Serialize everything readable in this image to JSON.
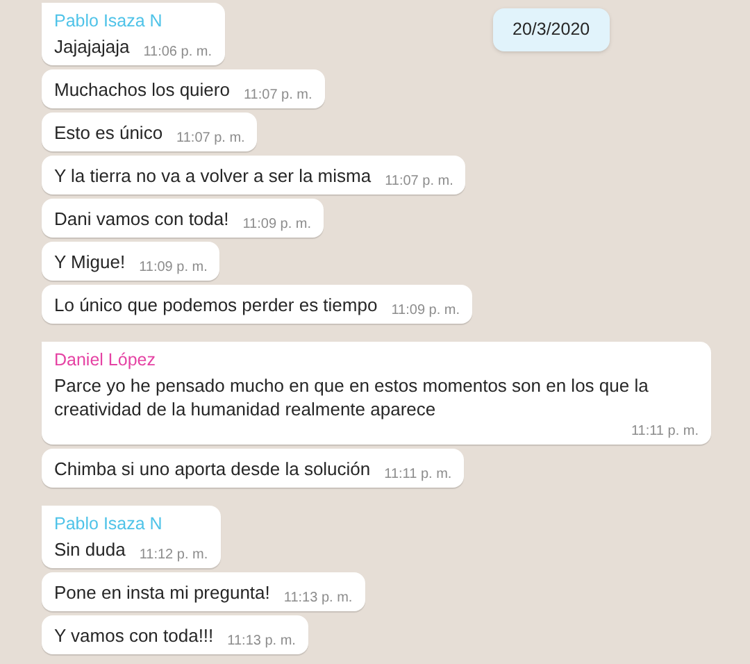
{
  "date_badge": "20/3/2020",
  "groups": [
    {
      "sender": "Pablo Isaza N",
      "color": "#4fc3e8",
      "messages": [
        {
          "text": "Jajajajaja",
          "time": "11:06 p. m."
        },
        {
          "text": "Muchachos los quiero",
          "time": "11:07 p. m."
        },
        {
          "text": "Esto es único",
          "time": "11:07 p. m."
        },
        {
          "text": "Y la tierra no va a volver a ser la misma",
          "time": "11:07 p. m."
        },
        {
          "text": "Dani vamos con toda!",
          "time": "11:09 p. m."
        },
        {
          "text": "Y Migue!",
          "time": "11:09 p. m."
        },
        {
          "text": "Lo único que podemos perder es tiempo",
          "time": "11:09 p. m."
        }
      ]
    },
    {
      "sender": "Daniel López",
      "color": "#e542a3",
      "messages": [
        {
          "text": "Parce yo he pensado mucho en que en estos momentos son en los que la creatividad de la humanidad realmente aparece",
          "time": "11:11 p. m."
        },
        {
          "text": "Chimba si uno aporta desde la solución",
          "time": "11:11 p. m."
        }
      ]
    },
    {
      "sender": "Pablo Isaza N",
      "color": "#4fc3e8",
      "messages": [
        {
          "text": "Sin duda",
          "time": "11:12 p. m."
        },
        {
          "text": "Pone en insta mi pregunta!",
          "time": "11:13 p. m."
        },
        {
          "text": "Y vamos con toda!!!",
          "time": "11:13 p. m."
        }
      ]
    }
  ]
}
